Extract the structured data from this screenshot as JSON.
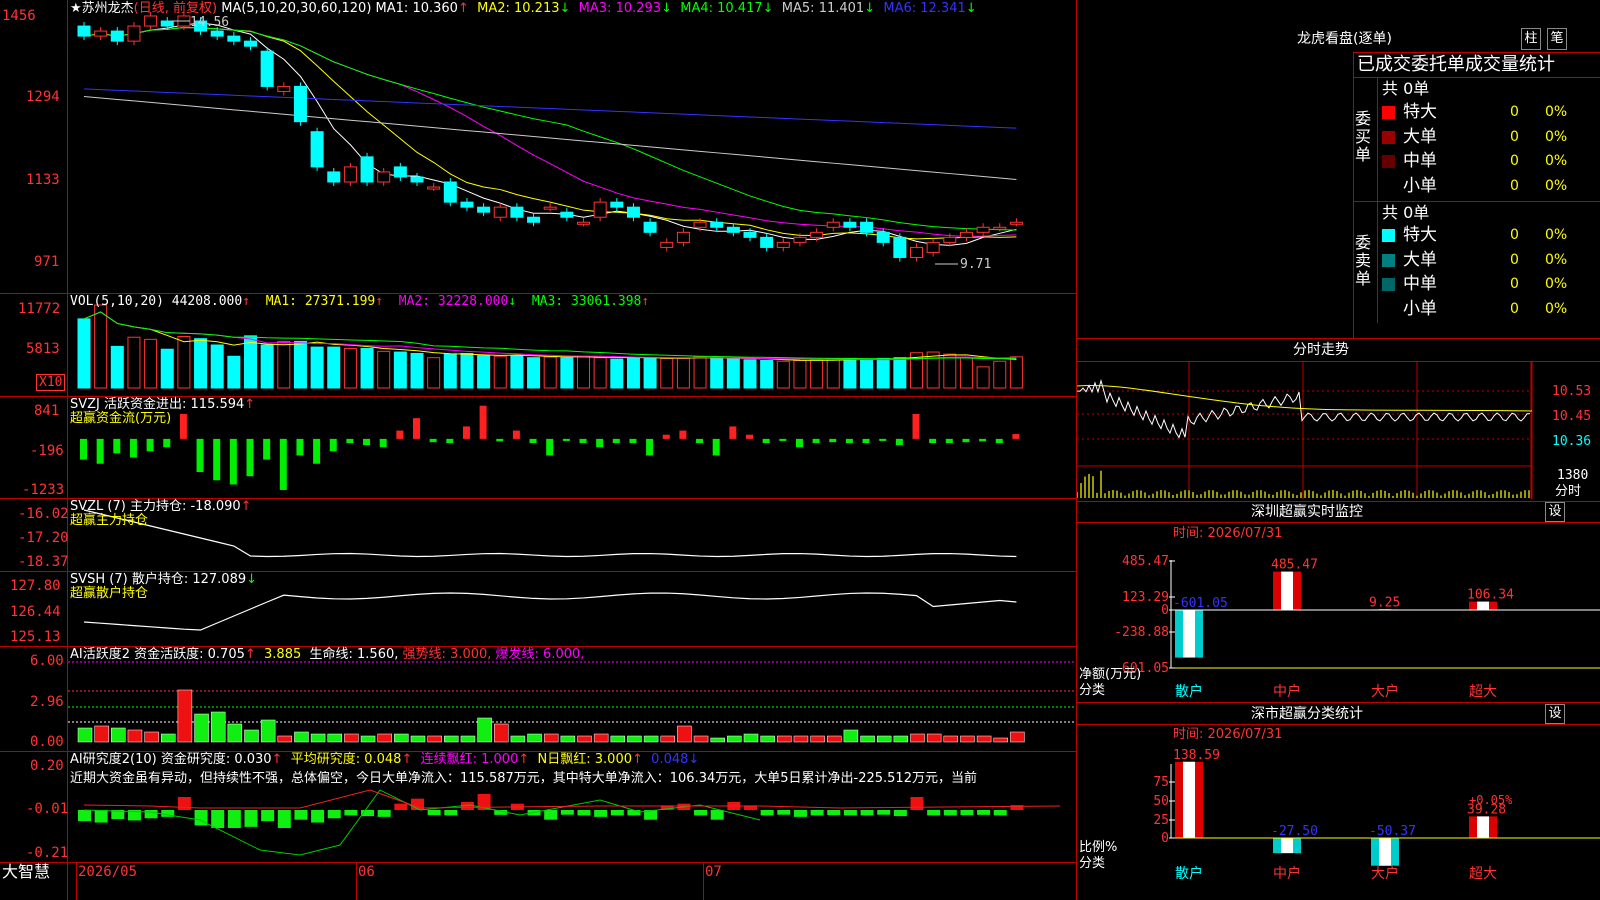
{
  "price_panel": {
    "star": "★",
    "title": "苏州龙杰",
    "mode": "(日线, 前复权)",
    "ma_label": "MA(5,10,20,30,60,120)",
    "ma": [
      {
        "label": "MA1:",
        "value": "10.360",
        "arrow": "↑",
        "color": "#ffffff"
      },
      {
        "label": "MA2:",
        "value": "10.213",
        "arrow": "↓",
        "color": "#ffff00"
      },
      {
        "label": "MA3:",
        "value": "10.293",
        "arrow": "↓",
        "color": "#ff00ff"
      },
      {
        "label": "MA4:",
        "value": "10.417",
        "arrow": "↓",
        "color": "#00ff00"
      },
      {
        "label": "MA5:",
        "value": "11.401",
        "arrow": "↓",
        "color": "#cccccc"
      },
      {
        "label": "MA6:",
        "value": "12.341",
        "arrow": "↓",
        "color": "#3333ff"
      }
    ],
    "y_ticks": [
      "1456",
      "1294",
      "1133",
      "971"
    ],
    "high_label": "14.56",
    "low_label": "9.71"
  },
  "vol_panel": {
    "label": "VOL(5,10,20)",
    "value": "44208.000",
    "ma": [
      {
        "label": "MA1:",
        "value": "27371.199",
        "arrow": "↑",
        "color": "#ffff00"
      },
      {
        "label": "MA2:",
        "value": "32228.000",
        "arrow": "↓",
        "color": "#ff00ff"
      },
      {
        "label": "MA3:",
        "value": "33061.398",
        "arrow": "↑",
        "color": "#00ff00"
      }
    ],
    "y_ticks": [
      "11772",
      "5813"
    ],
    "unit": "X10"
  },
  "svzj_panel": {
    "line1": "SVZJ  活跃资金进出: 115.594",
    "arrow": "↑",
    "line2": "超赢资金流(万元)",
    "y_ticks": [
      "841",
      "-196",
      "-1233"
    ]
  },
  "svzl_panel": {
    "line1": "SVZL (7) 主力持仓: -18.090",
    "arrow": "↑",
    "line2": "超赢主力持仓",
    "y_ticks": [
      "-16.02",
      "-17.20",
      "-18.37"
    ]
  },
  "svsh_panel": {
    "line1": "SVSH (7) 散户持仓: 127.089",
    "arrow": "↓",
    "line2": "超赢散户持仓",
    "y_ticks": [
      "127.80",
      "126.44",
      "125.13"
    ]
  },
  "ai_active": {
    "label": "AI活跃度2 资金活跃度: 0.705",
    "v2": "3.885",
    "v3": "生命线: 1.560,",
    "v4": "强势线: 3.000,",
    "v5": "爆发线: 6.000,",
    "y_ticks": [
      "6.00",
      "2.96",
      "0.00"
    ]
  },
  "ai_research": {
    "label": "AI研究度2(10) 资金研究度: 0.030",
    "v2": "平均研究度: 0.048",
    "v3": "连续飘红: 1.000",
    "v4": "N日飘红: 3.000",
    "v5": "0.048",
    "y_ticks": [
      "0.20",
      "-0.01",
      "-0.21"
    ],
    "comment": "近期大资金虽有异动，但持续性不强，总体偏空，今日大单净流入：115.587万元，其中特大单净流入：106.34万元，大单5日累计净出-225.512万元，当前"
  },
  "x_axis": {
    "brand": "大智慧",
    "dates": [
      "2026/05",
      "06",
      "07"
    ]
  },
  "dragon_tiger": {
    "title": "龙虎看盘(逐单)",
    "btn1": "柱",
    "btn2": "笔",
    "subtitle": "已成交委托单成交量统计",
    "buy_label": "委买单",
    "sell_label": "委卖单",
    "buy_total": "共 0单",
    "sell_total": "共 0单",
    "buy_rows": [
      {
        "name": "特大",
        "value": "0",
        "pct": "0%",
        "color": "#ff0000"
      },
      {
        "name": "大单",
        "value": "0",
        "pct": "0%",
        "color": "#990000"
      },
      {
        "name": "中单",
        "value": "0",
        "pct": "0%",
        "color": "#660000"
      },
      {
        "name": "小单",
        "value": "0",
        "pct": "0%",
        "color": "#000000"
      }
    ],
    "sell_rows": [
      {
        "name": "特大",
        "value": "0",
        "pct": "0%",
        "color": "#00ffff"
      },
      {
        "name": "大单",
        "value": "0",
        "pct": "0%",
        "color": "#008080"
      },
      {
        "name": "中单",
        "value": "0",
        "pct": "0%",
        "color": "#006666"
      },
      {
        "name": "小单",
        "value": "0",
        "pct": "0%",
        "color": "#000000"
      }
    ]
  },
  "intraday": {
    "title": "分时走势",
    "y_ticks": [
      "10.53",
      "10.45",
      "10.36"
    ],
    "vol_label": "1380",
    "unit": "分时"
  },
  "monitor": {
    "title": "深圳超赢实时监控",
    "setting": "设",
    "time": "时间: 2026/07/31",
    "y_ticks": [
      "485.47",
      "123.29",
      "0",
      "-238.88",
      "-601.05"
    ],
    "bars": [
      {
        "cat": "散户",
        "value": "-601.05",
        "num": -601.05
      },
      {
        "cat": "中户",
        "value": "485.47",
        "num": 485.47
      },
      {
        "cat": "大户",
        "value": "9.25",
        "num": 9.25
      },
      {
        "cat": "超大",
        "value": "106.34",
        "num": 106.34
      }
    ],
    "ylabel": "净额(万元)",
    "xlabel": "分类"
  },
  "classify": {
    "title": "深市超赢分类统计",
    "setting": "设",
    "time": "时间: 2026/07/31",
    "y_ticks": [
      "75",
      "50",
      "25",
      "0"
    ],
    "note": "+0.05%",
    "bars": [
      {
        "cat": "散户",
        "value": "138.59",
        "num": 138.59
      },
      {
        "cat": "中户",
        "value": "-27.50",
        "num": -27.5
      },
      {
        "cat": "大户",
        "value": "-50.37",
        "num": -50.37
      },
      {
        "cat": "超大",
        "value": "39.28",
        "num": 39.28
      }
    ],
    "ylabel": "比例%",
    "xlabel": "分类"
  },
  "chart_data": {
    "type": "candlestick",
    "ohlc_open": [
      14.4,
      14.2,
      14.3,
      14.1,
      14.4,
      14.5,
      14.4,
      14.5,
      14.3,
      14.2,
      14.1,
      13.9,
      13.1,
      13.2,
      12.3,
      11.5,
      11.3,
      11.8,
      11.3,
      11.6,
      11.4,
      11.2,
      11.3,
      10.9,
      10.8,
      10.6,
      10.8,
      10.6,
      10.8,
      10.7,
      10.5,
      10.6,
      10.9,
      10.8,
      10.5,
      10.0,
      10.1,
      10.4,
      10.5,
      10.4,
      10.3,
      10.2,
      10.0,
      10.1,
      10.2,
      10.4,
      10.5,
      10.5,
      10.3,
      10.2,
      9.8,
      9.9,
      10.1,
      10.2,
      10.3,
      10.4,
      10.5
    ],
    "ohlc_close": [
      14.2,
      14.3,
      14.1,
      14.4,
      14.6,
      14.4,
      14.6,
      14.3,
      14.2,
      14.1,
      14.0,
      13.2,
      13.2,
      12.5,
      11.6,
      11.3,
      11.6,
      11.3,
      11.5,
      11.4,
      11.3,
      11.2,
      10.9,
      10.8,
      10.7,
      10.8,
      10.6,
      10.5,
      10.8,
      10.6,
      10.5,
      10.9,
      10.8,
      10.6,
      10.3,
      10.1,
      10.3,
      10.5,
      10.4,
      10.3,
      10.2,
      10.0,
      10.1,
      10.2,
      10.3,
      10.5,
      10.4,
      10.3,
      10.1,
      9.8,
      10.0,
      10.1,
      10.2,
      10.3,
      10.4,
      10.4,
      10.5
    ],
    "volume_x10": [
      9800,
      11772,
      5900,
      7200,
      6900,
      5500,
      7300,
      7000,
      6100,
      4500,
      7400,
      6100,
      6600,
      6600,
      5800,
      5800,
      5600,
      5600,
      5200,
      5100,
      4900,
      4300,
      4800,
      4900,
      4600,
      4500,
      4600,
      4300,
      4400,
      4300,
      4500,
      4300,
      4100,
      4300,
      4300,
      4200,
      4200,
      4400,
      4300,
      4100,
      4000,
      3900,
      3800,
      3900,
      4000,
      4100,
      4200,
      4000,
      4200,
      4300,
      5000,
      5100,
      4800,
      4300,
      3000,
      3800,
      4420
    ],
    "fund_flow": [
      -500,
      -600,
      -350,
      -450,
      -300,
      -200,
      600,
      -800,
      -1000,
      -1100,
      -900,
      -500,
      -1233,
      -400,
      -600,
      -300,
      -100,
      -150,
      -200,
      200,
      500,
      -80,
      -100,
      300,
      800,
      -60,
      200,
      -100,
      -400,
      -50,
      -100,
      -200,
      -100,
      -100,
      -400,
      100,
      200,
      -100,
      -400,
      300,
      100,
      -100,
      -50,
      -200,
      -100,
      -80,
      -100,
      -100,
      -50,
      -150,
      600,
      -100,
      -100,
      -80,
      -60,
      -100,
      115.594
    ],
    "title": "苏州龙杰 (日线, 前复权)",
    "ylim": [
      9.71,
      14.56
    ]
  }
}
